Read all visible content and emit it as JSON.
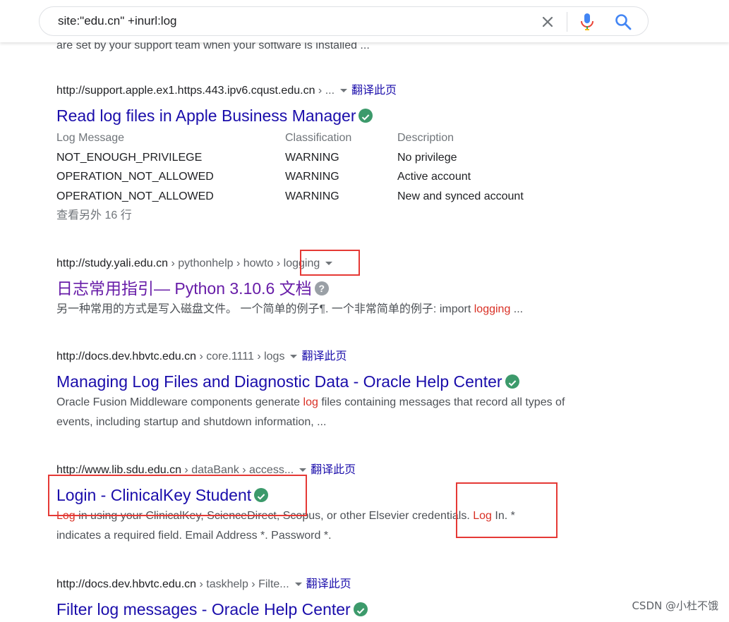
{
  "search": {
    "query": "site:\"edu.cn\" +inurl:log"
  },
  "top_snippet": "are set by your support team when your software is installed ...",
  "results": [
    {
      "url": "http://support.apple.ex1.https.443.ipv6.cqust.edu.cn",
      "path": " › ...",
      "translate": "翻译此页",
      "title": "Read log files in Apple Business Manager",
      "table": {
        "headers": [
          "Log Message",
          "Classification",
          "Description"
        ],
        "rows": [
          [
            "NOT_ENOUGH_PRIVILEGE",
            "WARNING",
            "No privilege"
          ],
          [
            "OPERATION_NOT_ALLOWED",
            "WARNING",
            "Active account"
          ],
          [
            "OPERATION_NOT_ALLOWED",
            "WARNING",
            "New and synced account"
          ]
        ],
        "more": "查看另外 16 行"
      }
    },
    {
      "url": "http://study.yali.edu.cn",
      "path": " › pythonhelp › howto › ",
      "path_last": "logging",
      "title": "日志常用指引— Python 3.10.6 文档",
      "desc_before": "另一种常用的方式是写入磁盘文件。 一个简单的例子¶. 一个非常简单的例子: import ",
      "desc_hl": "logging",
      "desc_after": " ..."
    },
    {
      "url": "http://docs.dev.hbvtc.edu.cn",
      "path": " › core.1111 › logs",
      "translate": "翻译此页",
      "title": "Managing Log Files and Diagnostic Data - Oracle Help Center",
      "desc_before": "Oracle Fusion Middleware components generate ",
      "desc_hl": "log",
      "desc_after": " files containing messages that record all types of events, including startup and shutdown information, ..."
    },
    {
      "url": "http://www.lib.sdu.edu.cn",
      "path": " › dataBank › access...",
      "translate": "翻译此页",
      "title": "Login - ClinicalKey Student",
      "desc_hl1": "Log",
      "desc_mid": " in using your ClinicalKey, ScienceDirect, Scopus, or other Elsevier credentials. ",
      "desc_hl2": "Log",
      "desc_after": " In. *",
      "desc_line2": "indicates a required field. Email Address *. Password *."
    },
    {
      "url": "http://docs.dev.hbvtc.edu.cn",
      "path": " › taskhelp › Filte...",
      "translate": "翻译此页",
      "title": "Filter log messages - Oracle Help Center"
    }
  ],
  "watermark": "CSDN @小杜不饿"
}
